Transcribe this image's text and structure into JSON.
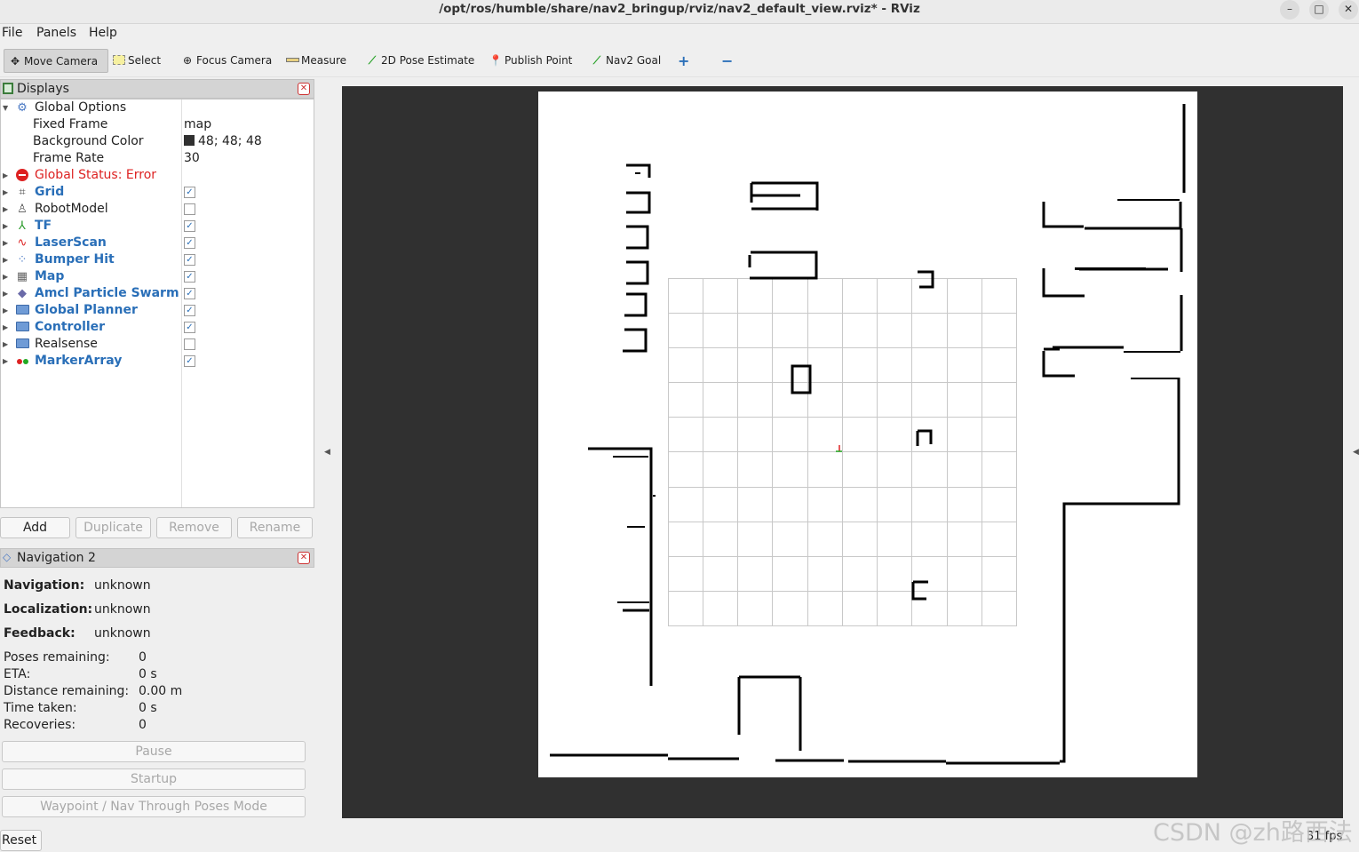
{
  "window": {
    "title": "/opt/ros/humble/share/nav2_bringup/rviz/nav2_default_view.rviz* - RViz",
    "controls": {
      "minimize": "–",
      "maximize": "□",
      "close": "✕"
    }
  },
  "menu": [
    "File",
    "Panels",
    "Help"
  ],
  "toolbar": {
    "move_camera": "Move Camera",
    "select": "Select",
    "focus_camera": "Focus Camera",
    "measure": "Measure",
    "pose_estimate": "2D Pose Estimate",
    "publish_point": "Publish Point",
    "nav2_goal": "Nav2 Goal",
    "add_tool": "+",
    "remove_tool": "−"
  },
  "displays": {
    "title": "Displays",
    "global_options": {
      "label": "Global Options",
      "fixed_frame_label": "Fixed Frame",
      "fixed_frame": "map",
      "background_color_label": "Background Color",
      "background_color": "48; 48; 48",
      "frame_rate_label": "Frame Rate",
      "frame_rate": "30"
    },
    "global_status": "Global Status: Error",
    "items": [
      {
        "label": "Grid",
        "checked": true,
        "highlighted": true
      },
      {
        "label": "RobotModel",
        "checked": false,
        "highlighted": false
      },
      {
        "label": "TF",
        "checked": true,
        "highlighted": true
      },
      {
        "label": "LaserScan",
        "checked": true,
        "highlighted": true
      },
      {
        "label": "Bumper Hit",
        "checked": true,
        "highlighted": true
      },
      {
        "label": "Map",
        "checked": true,
        "highlighted": true
      },
      {
        "label": "Amcl Particle Swarm",
        "checked": true,
        "highlighted": true
      },
      {
        "label": "Global Planner",
        "checked": true,
        "highlighted": true
      },
      {
        "label": "Controller",
        "checked": true,
        "highlighted": true
      },
      {
        "label": "Realsense",
        "checked": false,
        "highlighted": false
      },
      {
        "label": "MarkerArray",
        "checked": true,
        "highlighted": true
      }
    ],
    "buttons": {
      "add": "Add",
      "duplicate": "Duplicate",
      "remove": "Remove",
      "rename": "Rename"
    }
  },
  "navigation": {
    "title": "Navigation 2",
    "navigation_label": "Navigation:",
    "navigation_value": "unknown",
    "localization_label": "Localization:",
    "localization_value": "unknown",
    "feedback_label": "Feedback:",
    "feedback_value": "unknown",
    "poses_remaining_label": "Poses remaining:",
    "poses_remaining": "0",
    "eta_label": "ETA:",
    "eta": "0 s",
    "distance_label": "Distance remaining:",
    "distance": "0.00 m",
    "time_label": "Time taken:",
    "time": "0 s",
    "recoveries_label": "Recoveries:",
    "recoveries": "0",
    "pause": "Pause",
    "startup": "Startup",
    "waypoint_mode": "Waypoint / Nav Through Poses Mode"
  },
  "reset": "Reset",
  "fps": "31 fps",
  "watermark": "CSDN @zh路西法",
  "colors": {
    "background": "#303030",
    "accent": "#2a6fb8",
    "error": "#dd2222"
  }
}
